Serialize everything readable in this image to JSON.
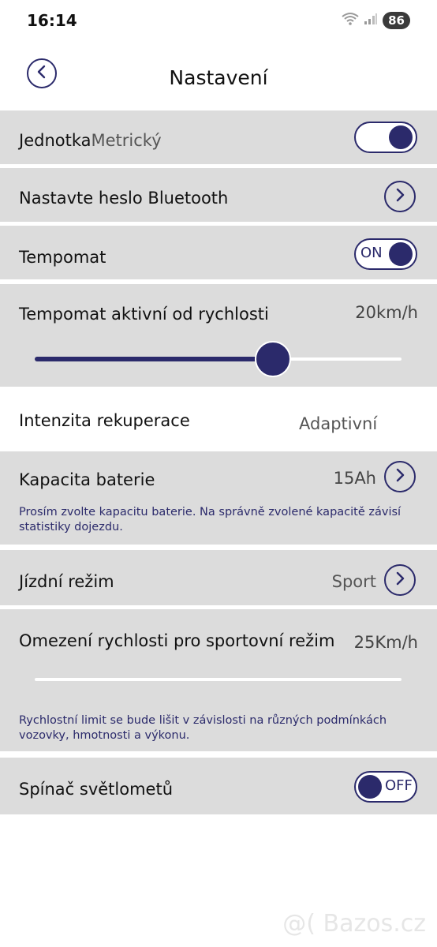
{
  "status_bar": {
    "time": "16:14",
    "battery": "86",
    "wifi_badge": "5"
  },
  "header": {
    "title": "Nastavení"
  },
  "rows": {
    "unit": {
      "label": "Jednotka",
      "value": "Metrický"
    },
    "bluetooth": {
      "label": "Nastavte heslo Bluetooth"
    },
    "cruise": {
      "label": "Tempomat",
      "toggle_text": "ON",
      "state": "on"
    },
    "cruise_speed": {
      "label": "Tempomat aktivní od rychlosti",
      "value": "20km/h",
      "slider_fraction": 0.65
    },
    "recuperation": {
      "label": "Intenzita rekuperace",
      "value": "Adaptivní"
    },
    "battery": {
      "label": "Kapacita baterie",
      "value": "15Ah",
      "note": "Prosím zvolte kapacitu baterie. Na správně zvolené kapacitě závisí statistiky dojezdu."
    },
    "ride_mode": {
      "label": "Jízdní režim",
      "value": "Sport"
    },
    "sport_limit": {
      "label": "Omezení rychlosti pro sportovní režim",
      "value": "25Km/h",
      "slider_fraction": 0.0,
      "note": "Rychlostní limit se bude lišit v závislosti na různých podmínkách vozovky, hmotnosti a výkonu."
    },
    "headlight": {
      "label": "Spínač světlometů",
      "toggle_text": "OFF",
      "state": "off"
    }
  },
  "watermark": "@( Bazos.cz",
  "colors": {
    "accent": "#2b2a6b",
    "row_bg": "#dcdcdc",
    "page_bg": "#ffffff"
  }
}
